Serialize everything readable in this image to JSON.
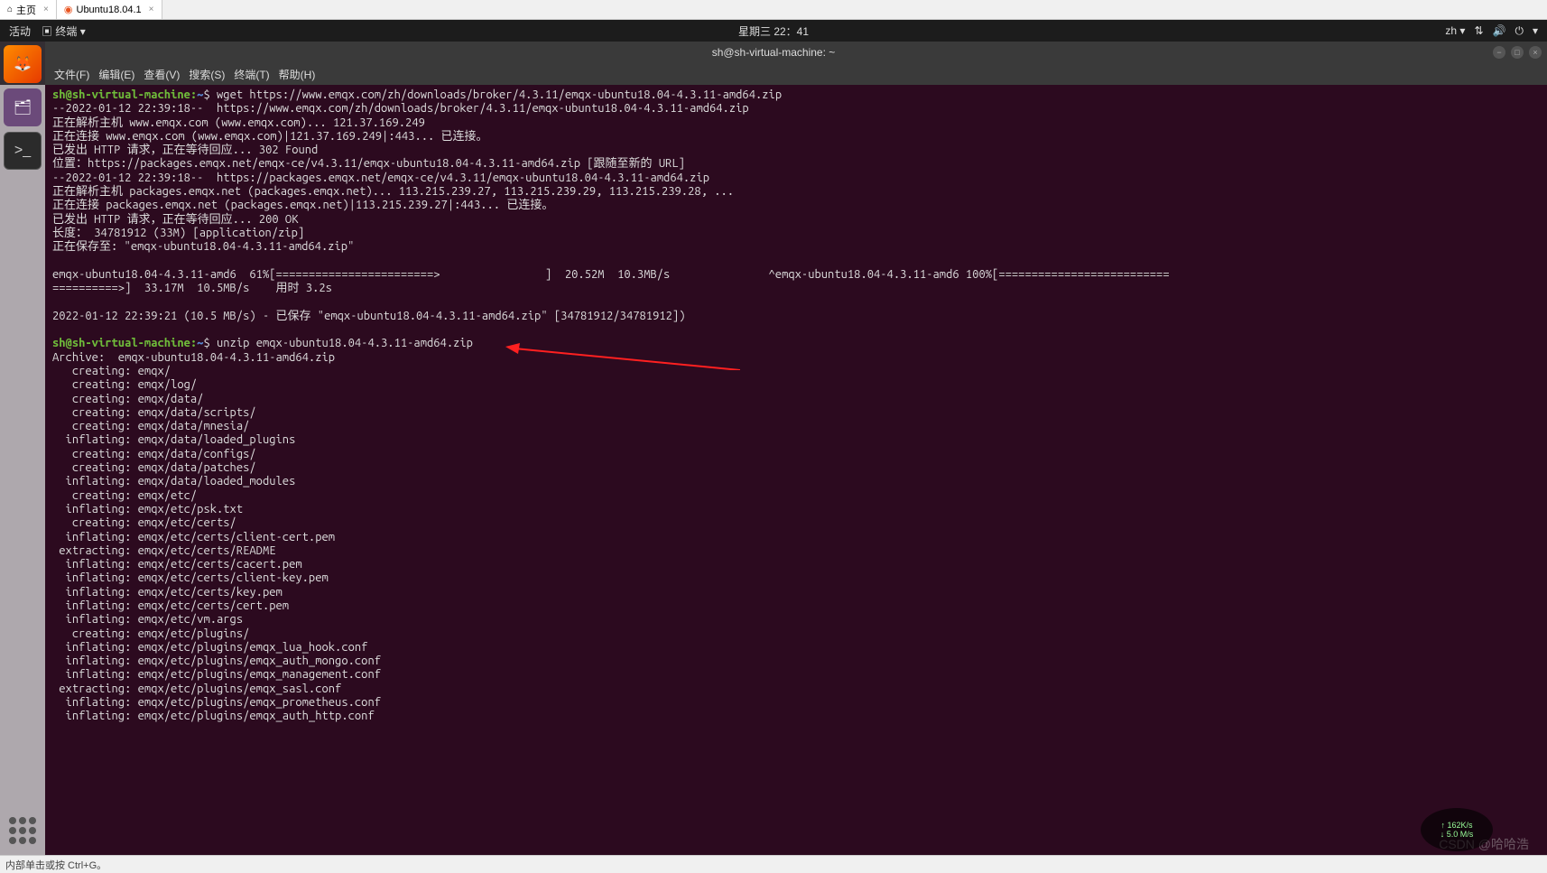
{
  "tabs": {
    "home": "主页",
    "vm": "Ubuntu18.04.1"
  },
  "topbar": {
    "activities": "活动",
    "terminal_label": "终端",
    "datetime": "星期三 22：41",
    "lang": "zh"
  },
  "window": {
    "title": "sh@sh-virtual-machine: ~"
  },
  "menu": {
    "file": "文件(F)",
    "edit": "编辑(E)",
    "view": "查看(V)",
    "search": "搜索(S)",
    "terminal": "终端(T)",
    "help": "帮助(H)"
  },
  "prompt": {
    "userhost": "sh@sh-virtual-machine:",
    "path": "~",
    "sym": "$"
  },
  "commands": {
    "wget": "wget https://www.emqx.com/zh/downloads/broker/4.3.11/emqx-ubuntu18.04-4.3.11-amd64.zip",
    "unzip": "unzip emqx-ubuntu18.04-4.3.11-amd64.zip"
  },
  "wget_output": [
    "--2022-01-12 22:39:18--  https://www.emqx.com/zh/downloads/broker/4.3.11/emqx-ubuntu18.04-4.3.11-amd64.zip",
    "正在解析主机 www.emqx.com (www.emqx.com)... 121.37.169.249",
    "正在连接 www.emqx.com (www.emqx.com)|121.37.169.249|:443... 已连接。",
    "已发出 HTTP 请求，正在等待回应... 302 Found",
    "位置：https://packages.emqx.net/emqx-ce/v4.3.11/emqx-ubuntu18.04-4.3.11-amd64.zip [跟随至新的 URL]",
    "--2022-01-12 22:39:18--  https://packages.emqx.net/emqx-ce/v4.3.11/emqx-ubuntu18.04-4.3.11-amd64.zip",
    "正在解析主机 packages.emqx.net (packages.emqx.net)... 113.215.239.27, 113.215.239.29, 113.215.239.28, ...",
    "正在连接 packages.emqx.net (packages.emqx.net)|113.215.239.27|:443... 已连接。",
    "已发出 HTTP 请求，正在等待回应... 200 OK",
    "长度： 34781912 (33M) [application/zip]",
    "正在保存至: \"emqx-ubuntu18.04-4.3.11-amd64.zip\"",
    "",
    "emqx-ubuntu18.04-4.3.11-amd6  61%[========================>                ]  20.52M  10.3MB/s               ^emqx-ubuntu18.04-4.3.11-amd6 100%[==========================",
    "==========>]  33.17M  10.5MB/s    用时 3.2s",
    "",
    "2022-01-12 22:39:21 (10.5 MB/s) - 已保存 \"emqx-ubuntu18.04-4.3.11-amd64.zip\" [34781912/34781912])",
    ""
  ],
  "unzip_output": [
    "Archive:  emqx-ubuntu18.04-4.3.11-amd64.zip",
    "   creating: emqx/",
    "   creating: emqx/log/",
    "   creating: emqx/data/",
    "   creating: emqx/data/scripts/",
    "   creating: emqx/data/mnesia/",
    "  inflating: emqx/data/loaded_plugins",
    "   creating: emqx/data/configs/",
    "   creating: emqx/data/patches/",
    "  inflating: emqx/data/loaded_modules",
    "   creating: emqx/etc/",
    "  inflating: emqx/etc/psk.txt",
    "   creating: emqx/etc/certs/",
    "  inflating: emqx/etc/certs/client-cert.pem",
    " extracting: emqx/etc/certs/README",
    "  inflating: emqx/etc/certs/cacert.pem",
    "  inflating: emqx/etc/certs/client-key.pem",
    "  inflating: emqx/etc/certs/key.pem",
    "  inflating: emqx/etc/certs/cert.pem",
    "  inflating: emqx/etc/vm.args",
    "   creating: emqx/etc/plugins/",
    "  inflating: emqx/etc/plugins/emqx_lua_hook.conf",
    "  inflating: emqx/etc/plugins/emqx_auth_mongo.conf",
    "  inflating: emqx/etc/plugins/emqx_management.conf",
    " extracting: emqx/etc/plugins/emqx_sasl.conf",
    "  inflating: emqx/etc/plugins/emqx_prometheus.conf",
    "  inflating: emqx/etc/plugins/emqx_auth_http.conf"
  ],
  "statusbar": {
    "text": "内部单击或按 Ctrl+G。"
  },
  "netspeed": {
    "up": "↑ 162K/s",
    "down": "↓ 5.0 M/s"
  },
  "watermark": "CSDN @哈哈浩"
}
